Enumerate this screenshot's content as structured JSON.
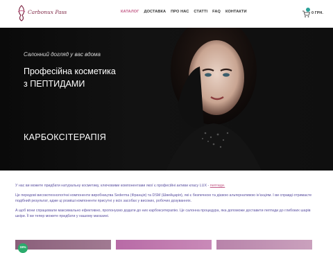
{
  "brand": {
    "name": "Carbonux Pass",
    "accent": "#c25a86",
    "text_color": "#5a4fa0"
  },
  "nav": {
    "items": [
      {
        "label": "КАТАЛОГ",
        "active": true
      },
      {
        "label": "ДОСТАВКА",
        "active": false
      },
      {
        "label": "ПРО НАС",
        "active": false
      },
      {
        "label": "СТАТТІ",
        "active": false
      },
      {
        "label": "FAQ",
        "active": false
      },
      {
        "label": "КОНТАКТИ",
        "active": false
      }
    ]
  },
  "cart": {
    "total": "0 ГРН.",
    "icon": "cart-icon"
  },
  "hero": {
    "subtitle": "Салонний догляд у вас вдома",
    "title_line1": "Професійна косметика",
    "title_line2": "з ПЕПТИДАМИ",
    "section_label": "КАРБОКСІТЕРАПІЯ"
  },
  "content": {
    "p1_text": "У нас ви можете придбати натуральну косметику, ключовими компонентами якої є професійні активи класу LUX - ",
    "p1_link": "пептиди.",
    "p2": "Це передові високотехнологічні компоненти виробництва Sederma (Франція) та DSM (Швейцарія), які є безпечною та дієвою альтернативою ін'єкціям. І ви справді отримаєте подібний результат, адже ці розвіші компоненти присутні у всіх засобах у високих, робочих дозуваннях.",
    "p3": "А щоб вони спрацювали максимально ефективно, пропонуємо додати до них карбокситерапію. Це салонна процедура, яка допоможе доставити пептиди до глибоких шарів шкіри. Її ви тепер можете придбати у нашому магазині."
  },
  "cards": {
    "badge": "15%"
  }
}
